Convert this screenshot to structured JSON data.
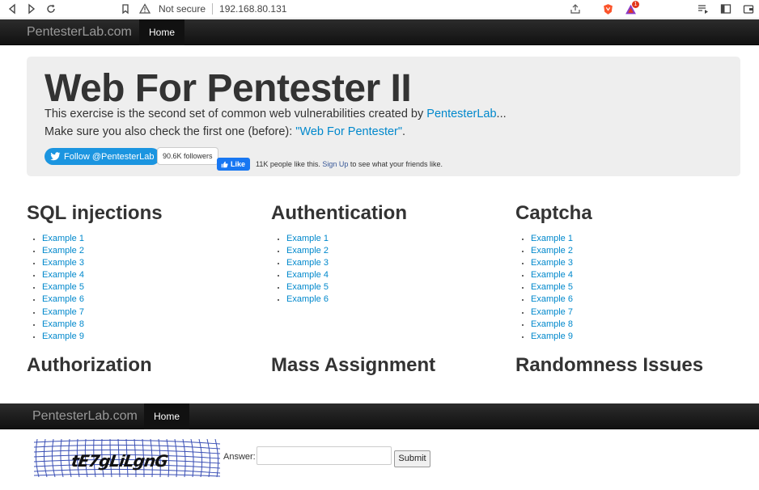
{
  "browser": {
    "security_label": "Not secure",
    "url": "192.168.80.131",
    "notification_count": "1"
  },
  "navbar": {
    "brand": "PentesterLab.com",
    "home": "Home"
  },
  "hero": {
    "title": "Web For Pentester II",
    "line1_text": "This exercise is the second set of common web vulnerabilities created by ",
    "line1_link": "PentesterLab",
    "line1_suffix": "...",
    "line2_text": "Make sure you also check the first one (before): ",
    "line2_link": "\"Web For Pentester\"",
    "line2_suffix": ".",
    "follow_label": "Follow @PentesterLab",
    "followers": "90.6K followers",
    "like_label": "Like",
    "like_text_pre": "11K people like this. ",
    "like_signup": "Sign Up",
    "like_text_post": " to see what your friends like."
  },
  "sections": {
    "sql": {
      "title": "SQL injections",
      "items": [
        "Example 1",
        "Example 2",
        "Example 3",
        "Example 4",
        "Example 5",
        "Example 6",
        "Example 7",
        "Example 8",
        "Example 9"
      ]
    },
    "auth": {
      "title": "Authentication",
      "items": [
        "Example 1",
        "Example 2",
        "Example 3",
        "Example 4",
        "Example 5",
        "Example 6"
      ]
    },
    "captcha": {
      "title": "Captcha",
      "items": [
        "Example 1",
        "Example 2",
        "Example 3",
        "Example 4",
        "Example 5",
        "Example 6",
        "Example 7",
        "Example 8",
        "Example 9"
      ]
    },
    "authorization": {
      "title": "Authorization"
    },
    "mass": {
      "title": "Mass Assignment"
    },
    "random": {
      "title": "Randomness Issues"
    }
  },
  "captcha_form": {
    "captcha_text": "tE7gLiLgnG",
    "answer_label": "Answer:",
    "answer_value": "",
    "submit_label": "Submit"
  },
  "colors": {
    "link": "#0088cc",
    "navbar_bg": "#1b1b1b",
    "hero_bg": "#eeeeee",
    "twitter": "#1b95e0",
    "facebook": "#1877f2"
  }
}
